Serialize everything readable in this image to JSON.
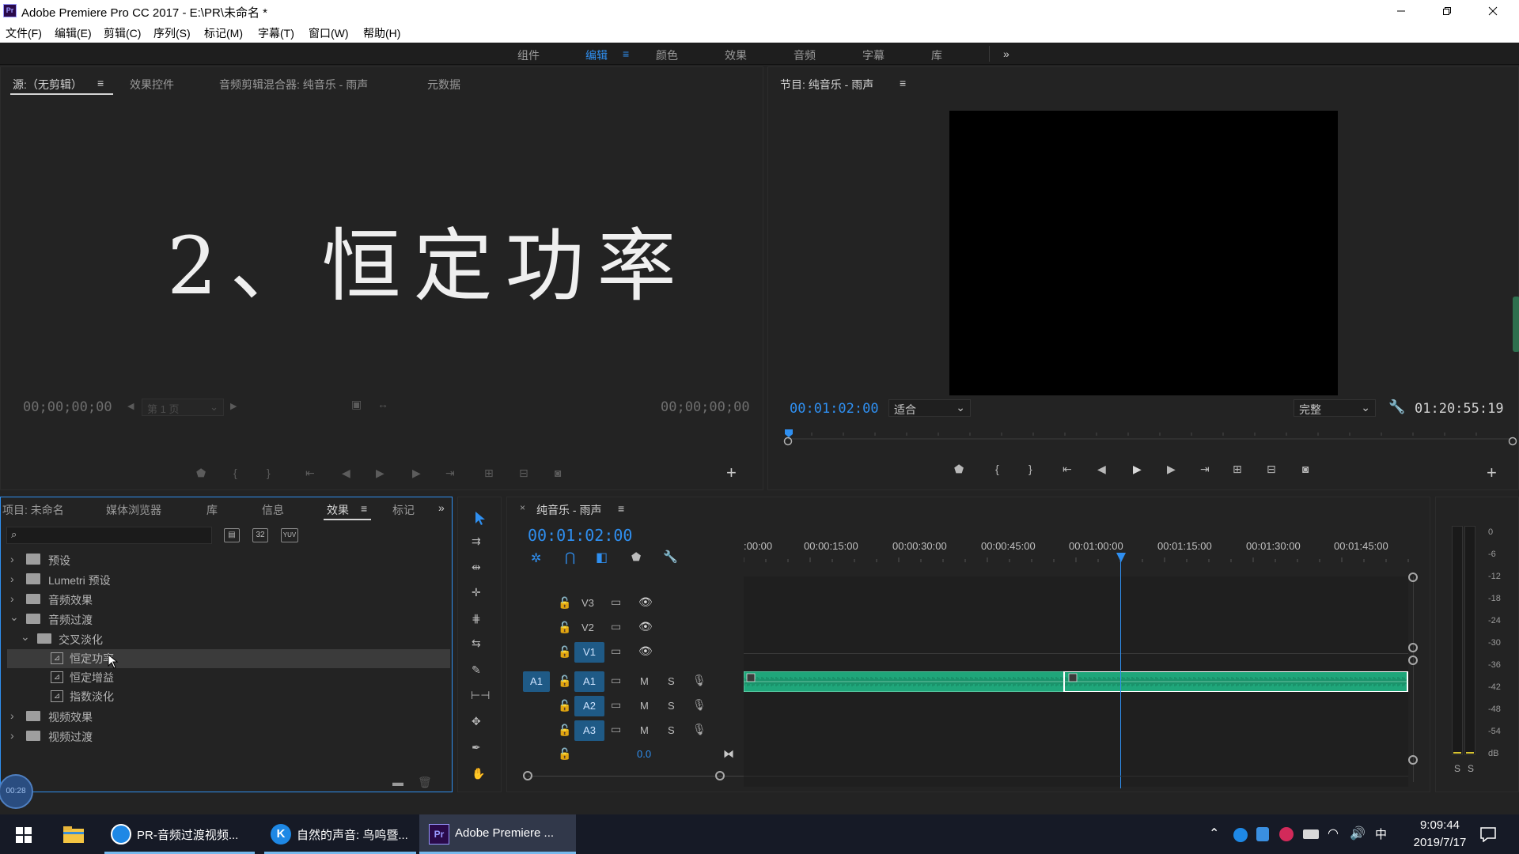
{
  "window": {
    "app_icon": "Pr",
    "title": "Adobe Premiere Pro CC 2017 - E:\\PR\\未命名 *"
  },
  "menu": [
    "文件(F)",
    "编辑(E)",
    "剪辑(C)",
    "序列(S)",
    "标记(M)",
    "字幕(T)",
    "窗口(W)",
    "帮助(H)"
  ],
  "workspaces": [
    "组件",
    "编辑",
    "颜色",
    "效果",
    "音频",
    "字幕",
    "库"
  ],
  "workspaces_more": "»",
  "source": {
    "tabs": [
      "源:（无剪辑）",
      "效果控件",
      "音频剪辑混合器: 纯音乐 - 雨声",
      "元数据"
    ],
    "menu_glyph": "≡",
    "overlay_text": "2、恒定功率",
    "timecode_left": "00;00;00;00",
    "timecode_right": "00;00;00;00",
    "page_select": "第 1 页"
  },
  "program": {
    "tab": "节目: 纯音乐 - 雨声",
    "menu_glyph": "≡",
    "timecode": "00:01:02:00",
    "fit": "适合",
    "quality": "完整",
    "duration": "01:20:55:19"
  },
  "effects_panel": {
    "tabs": [
      "项目: 未命名",
      "媒体浏览器",
      "库",
      "信息",
      "效果",
      "标记"
    ],
    "active_tab": "效果",
    "menu_glyph": "≡",
    "more": "»",
    "search_placeholder": "",
    "badges": [
      "32",
      "YUV"
    ],
    "tree": [
      {
        "label": "预设",
        "level": 0,
        "expanded": false,
        "type": "special-folder"
      },
      {
        "label": "Lumetri 预设",
        "level": 0,
        "expanded": false,
        "type": "special-folder"
      },
      {
        "label": "音频效果",
        "level": 0,
        "expanded": false,
        "type": "folder"
      },
      {
        "label": "音频过渡",
        "level": 0,
        "expanded": true,
        "type": "folder"
      },
      {
        "label": "交叉淡化",
        "level": 1,
        "expanded": true,
        "type": "folder"
      },
      {
        "label": "恒定功率",
        "level": 2,
        "selected": true,
        "type": "effect"
      },
      {
        "label": "恒定增益",
        "level": 2,
        "type": "effect"
      },
      {
        "label": "指数淡化",
        "level": 2,
        "type": "effect"
      },
      {
        "label": "视频效果",
        "level": 0,
        "expanded": false,
        "type": "folder"
      },
      {
        "label": "视频过渡",
        "level": 0,
        "expanded": false,
        "type": "folder"
      }
    ],
    "recording_badge": "00:28"
  },
  "timeline": {
    "tab": "纯音乐 - 雨声",
    "close_glyph": "×",
    "menu_glyph": "≡",
    "timecode": "00:01:02:00",
    "ruler": [
      ":00:00",
      "00:00:15:00",
      "00:00:30:00",
      "00:00:45:00",
      "00:01:00:00",
      "00:01:15:00",
      "00:01:30:00",
      "00:01:45:00"
    ],
    "playhead_seconds": 62,
    "video_tracks": [
      "V3",
      "V2",
      "V1"
    ],
    "audio_tracks": [
      "A1",
      "A2",
      "A3"
    ],
    "source_patch": "A1",
    "mute_label": "M",
    "solo_label": "S",
    "master_volume": "0.0",
    "clip_color": "#1fa67a",
    "accent": "#2f8ff0"
  },
  "meters": {
    "scale": [
      "0",
      "-6",
      "-12",
      "-18",
      "-24",
      "-30",
      "-36",
      "-42",
      "-48",
      "-54",
      "dB"
    ],
    "solo": [
      "S",
      "S"
    ]
  },
  "taskbar": {
    "apps": [
      {
        "label": "PR-音频过渡视频..."
      },
      {
        "label": "自然的声音: 鸟鸣暨..."
      },
      {
        "label": "Adobe Premiere ..."
      }
    ],
    "ime": "中",
    "time": "9:09:44",
    "date": "2019/7/17"
  }
}
